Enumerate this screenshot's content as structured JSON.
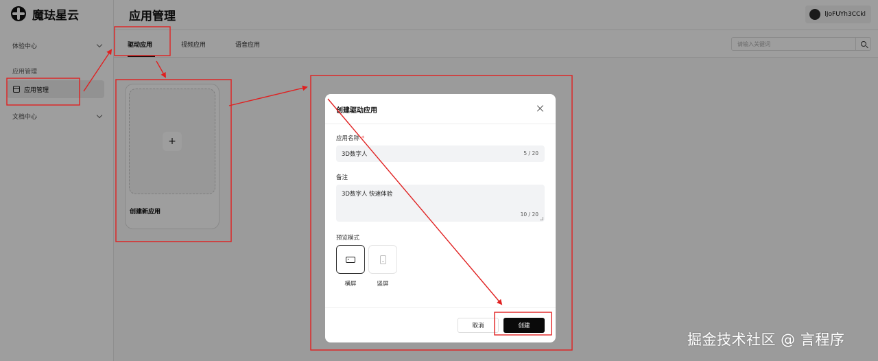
{
  "app": {
    "logo_text": "魔珐星云"
  },
  "sidebar": {
    "groups": [
      {
        "label": "体验中心"
      },
      {
        "label": "文档中心"
      }
    ],
    "section_label": "应用管理",
    "active_item": "应用管理"
  },
  "header": {
    "title": "应用管理",
    "user_name": "lJoFUYh3CCkl"
  },
  "tabs": [
    {
      "label": "驱动应用",
      "active": true
    },
    {
      "label": "视频应用",
      "active": false
    },
    {
      "label": "语音应用",
      "active": false
    }
  ],
  "search": {
    "placeholder": "请输入关键词",
    "value": ""
  },
  "new_card": {
    "label": "创建新应用",
    "plus": "+"
  },
  "modal": {
    "title": "创建驱动应用",
    "name_label": "应用名称",
    "name_required_mark": "*",
    "name_value": "3D数字人",
    "name_counter": "5 / 20",
    "note_label": "备注",
    "note_value": "3D数字人 快速体验",
    "note_counter": "10 / 20",
    "preview_label": "预览模式",
    "modes": [
      {
        "label": "横屏",
        "icon": "landscape-screen-icon",
        "selected": true
      },
      {
        "label": "竖屏",
        "icon": "portrait-screen-icon",
        "selected": false
      }
    ],
    "cancel_label": "取消",
    "create_label": "创建"
  },
  "colors": {
    "annotation": "#e02020",
    "primary_button": "#0a0a0a"
  },
  "watermark": "掘金技术社区 @ 言程序"
}
